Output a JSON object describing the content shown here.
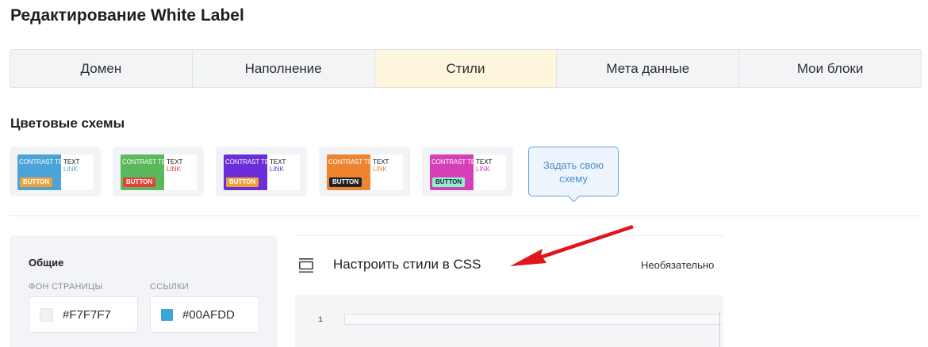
{
  "page": {
    "title": "Редактирование White Label"
  },
  "tabs": [
    {
      "label": "Домен",
      "active": false
    },
    {
      "label": "Наполнение",
      "active": false
    },
    {
      "label": "Стили",
      "active": true
    },
    {
      "label": "Мета данные",
      "active": false
    },
    {
      "label": "Мои блоки",
      "active": false
    }
  ],
  "color_schemes": {
    "title": "Цветовые схемы",
    "items": [
      {
        "contrast_text": "CONTRAST TEXT",
        "button": "BUTTON",
        "text": "TEXT",
        "link": "LINK",
        "primary": "#4ba3d8",
        "button_bg": "#f0a23a",
        "button_fg": "#ffffff",
        "link_color": "#4ba3d8"
      },
      {
        "contrast_text": "CONTRAST TEXT",
        "button": "BUTTON",
        "text": "TEXT",
        "link": "LINK",
        "primary": "#5cb85c",
        "button_bg": "#e0413a",
        "button_fg": "#ffffff",
        "link_color": "#e0413a"
      },
      {
        "contrast_text": "CONTRAST TEXT",
        "button": "BUTTON",
        "text": "TEXT",
        "link": "LINK",
        "primary": "#6a2fd8",
        "button_bg": "#f0a23a",
        "button_fg": "#ffffff",
        "link_color": "#6a2fd8"
      },
      {
        "contrast_text": "CONTRAST TEXT",
        "button": "BUTTON",
        "text": "TEXT",
        "link": "LINK",
        "primary": "#ee8430",
        "button_bg": "#222222",
        "button_fg": "#ffffff",
        "link_color": "#ee8430"
      },
      {
        "contrast_text": "CONTRAST TEXT",
        "button": "BUTTON",
        "text": "TEXT",
        "link": "LINK",
        "primary": "#d63fb8",
        "button_bg": "#8ff0d4",
        "button_fg": "#222222",
        "link_color": "#d63fb8"
      }
    ],
    "custom_label": "Задать свою схему"
  },
  "general": {
    "title": "Общие",
    "page_bg_label": "ФОН СТРАНИЦЫ",
    "page_bg_value": "#F7F7F7",
    "page_bg_swatch": "#f1f1f1",
    "links_label": "ССЫЛКИ",
    "links_value": "#00AFDD",
    "links_swatch": "#3aa6d8"
  },
  "css": {
    "title": "Настроить стили в CSS",
    "optional": "Необязательно",
    "line_number": "1"
  },
  "colors": {
    "annotation_arrow": "#e0161b",
    "active_tab": "#fdf6dc",
    "custom_accent": "#4a8fd8"
  }
}
